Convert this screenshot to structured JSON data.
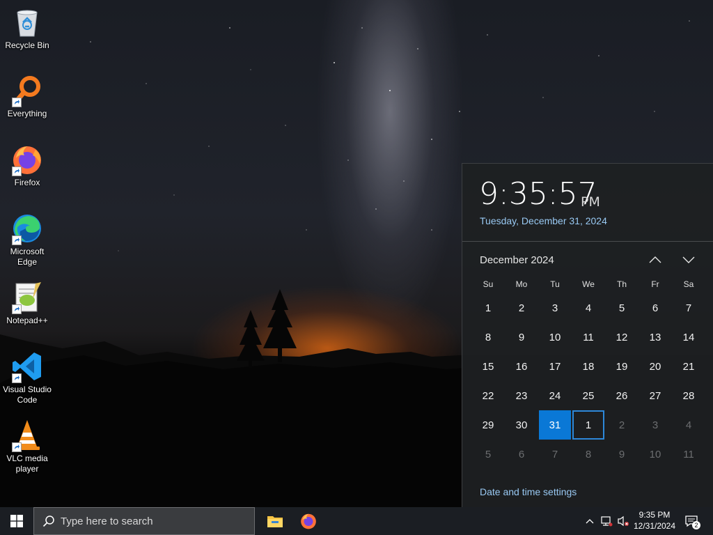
{
  "desktop": {
    "icons": [
      {
        "label": "Recycle Bin",
        "icon": "recycle-bin-icon"
      },
      {
        "label": "Everything",
        "icon": "everything-search-icon"
      },
      {
        "label": "Firefox",
        "icon": "firefox-icon"
      },
      {
        "label": "Microsoft Edge",
        "icon": "edge-icon"
      },
      {
        "label": "Notepad++",
        "icon": "notepad-plus-plus-icon"
      },
      {
        "label": "Visual Studio Code",
        "icon": "vscode-icon"
      },
      {
        "label": "VLC media player",
        "icon": "vlc-icon"
      }
    ]
  },
  "calendar": {
    "time": "9:35:57",
    "ampm": "PM",
    "long_date": "Tuesday, December 31, 2024",
    "month_label": "December 2024",
    "days_of_week": [
      "Su",
      "Mo",
      "Tu",
      "We",
      "Th",
      "Fr",
      "Sa"
    ],
    "weeks": [
      [
        "1",
        "2",
        "3",
        "4",
        "5",
        "6",
        "7"
      ],
      [
        "8",
        "9",
        "10",
        "11",
        "12",
        "13",
        "14"
      ],
      [
        "15",
        "16",
        "17",
        "18",
        "19",
        "20",
        "21"
      ],
      [
        "22",
        "23",
        "24",
        "25",
        "26",
        "27",
        "28"
      ],
      [
        "29",
        "30",
        "31",
        "1",
        "2",
        "3",
        "4"
      ],
      [
        "5",
        "6",
        "7",
        "8",
        "9",
        "10",
        "11"
      ]
    ],
    "today": "31",
    "settings_link": "Date and time settings",
    "accent_color": "#0a78d6",
    "link_color": "#99c9f3"
  },
  "taskbar": {
    "search_placeholder": "Type here to search",
    "pinned": [
      "file-explorer-icon",
      "firefox-icon"
    ],
    "tray": {
      "time": "9:35 PM",
      "date": "12/31/2024",
      "notification_count": "2"
    }
  }
}
